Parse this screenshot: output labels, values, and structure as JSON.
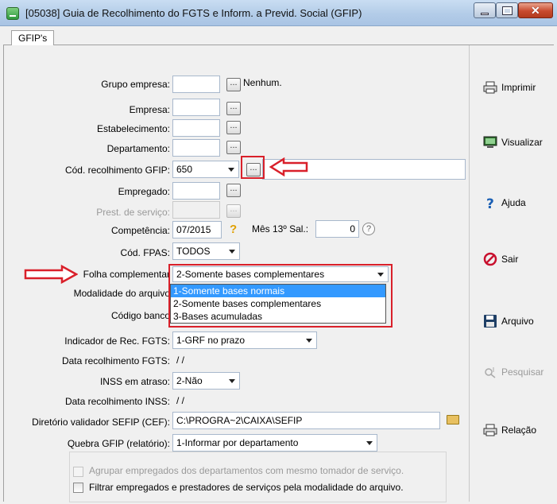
{
  "window": {
    "title": "[05038] Guia de Recolhimento do FGTS e Inform. a Previd. Social (GFIP)"
  },
  "tabs": [
    {
      "label": "GFIP's"
    }
  ],
  "form": {
    "grupo_empresa": {
      "label": "Grupo empresa:",
      "value": "",
      "note": "Nenhum."
    },
    "empresa": {
      "label": "Empresa:",
      "value": ""
    },
    "estabelecimento": {
      "label": "Estabelecimento:",
      "value": ""
    },
    "departamento": {
      "label": "Departamento:",
      "value": ""
    },
    "cod_recolhimento": {
      "label": "Cód. recolhimento GFIP:",
      "value": "650",
      "description": ""
    },
    "empregado": {
      "label": "Empregado:",
      "value": ""
    },
    "prest_servico": {
      "label": "Prest. de serviço:",
      "value": ""
    },
    "competencia": {
      "label": "Competência:",
      "value": "07/2015"
    },
    "mes13": {
      "label": "Mês 13º Sal.:",
      "value": "0"
    },
    "cod_fpas": {
      "label": "Cód. FPAS:",
      "value": "TODOS"
    },
    "folha_complementar": {
      "label": "Folha complementar",
      "value": "2-Somente bases complementares"
    },
    "modalidade": {
      "label": "Modalidade do arquivo"
    },
    "codigo_banco": {
      "label": "Código banco"
    },
    "indicador_rec": {
      "label": "Indicador de Rec. FGTS:",
      "value": "1-GRF no prazo"
    },
    "data_rec_fgts": {
      "label": "Data recolhimento FGTS:",
      "value": "/ /"
    },
    "inss_atraso": {
      "label": "INSS em atraso:",
      "value": "2-Não"
    },
    "data_rec_inss": {
      "label": "Data recolhimento INSS:",
      "value": "/ /"
    },
    "diretorio_sefip": {
      "label": "Diretório validador SEFIP (CEF):",
      "value": "C:\\PROGRA~2\\CAIXA\\SEFIP"
    },
    "quebra_gfip": {
      "label": "Quebra GFIP (relatório):",
      "value": "1-Informar por departamento"
    }
  },
  "dropdown_options": [
    {
      "label": "1-Somente bases normais",
      "selected": true
    },
    {
      "label": "2-Somente bases complementares",
      "selected": false
    },
    {
      "label": "3-Bases acumuladas",
      "selected": false
    }
  ],
  "checkboxes": [
    {
      "label": "Agrupar empregados dos departamentos com mesmo tomador de serviço.",
      "checked": false,
      "enabled": false
    },
    {
      "label": "Filtrar empregados e prestadores de serviços pela modalidade do arquivo.",
      "checked": false,
      "enabled": true
    }
  ],
  "side_buttons": {
    "imprimir": "Imprimir",
    "visualizar": "Visualizar",
    "ajuda": "Ajuda",
    "sair": "Sair",
    "arquivo": "Arquivo",
    "pesquisar": "Pesquisar",
    "relacao": "Relação"
  },
  "glyphs": {
    "ellipsis": "...",
    "question": "?"
  },
  "colors": {
    "annotation_red": "#d9202a",
    "selection_blue": "#3399ff",
    "window_bg": "#f0f0f0"
  },
  "icons": [
    "app-icon",
    "printer-icon",
    "monitor-icon",
    "help-icon",
    "stop-icon",
    "floppy-disk-icon",
    "search-icon",
    "folder-icon"
  ]
}
